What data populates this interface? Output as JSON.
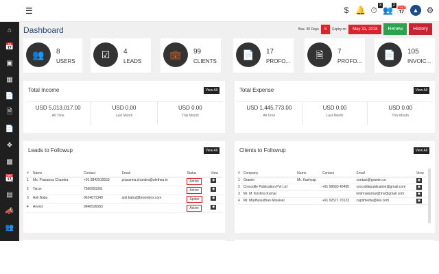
{
  "topbar": {
    "menu_icon": "hamburger-icon",
    "icons": [
      "dollar-icon",
      "bell-icon",
      "timer-icon",
      "users-icon",
      "calendar-icon",
      "settings-icon"
    ],
    "timer_badge": "3",
    "users_badge": "2"
  },
  "sidebar": {
    "items": [
      "home-icon",
      "calendar-icon",
      "id-card-icon",
      "address-card-icon",
      "file-icon",
      "file-text-icon",
      "file-icon",
      "cubes-icon",
      "money-icon",
      "calendar-check-icon",
      "list-icon",
      "bullhorn-icon",
      "users-icon"
    ]
  },
  "header": {
    "title": "Dashboard",
    "sub_label": "Bus. 30 Days",
    "days": "8",
    "expire_label": "Expiry on",
    "expire_date": "May 31, 2018",
    "renew": "Renew",
    "history": "History"
  },
  "stats": [
    {
      "value": "8",
      "label": "USERS",
      "icon": "users-icon"
    },
    {
      "value": "4",
      "label": "LEADS",
      "icon": "check-square-icon"
    },
    {
      "value": "99",
      "label": "CLIENTS",
      "icon": "briefcase-icon"
    },
    {
      "value": "17",
      "label": "PROFO...",
      "icon": "file-icon"
    },
    {
      "value": "7",
      "label": "PROFO...",
      "icon": "file-text-icon"
    },
    {
      "value": "105",
      "label": "INVOIC...",
      "icon": "file-icon"
    }
  ],
  "income": {
    "title": "Total Income",
    "view_all": "View All",
    "cols": [
      {
        "value": "USD 5,013,017.00",
        "label": "All Time"
      },
      {
        "value": "USD 0.00",
        "label": "Last Month"
      },
      {
        "value": "USD 0.00",
        "label": "This Month"
      }
    ]
  },
  "expense": {
    "title": "Total Expense",
    "view_all": "View All",
    "cols": [
      {
        "value": "USD 1,445,773.00",
        "label": "All Time"
      },
      {
        "value": "USD 0.00",
        "label": "Last Month"
      },
      {
        "value": "USD 0.00",
        "label": "This Month"
      }
    ]
  },
  "leads": {
    "title": "Leads to Followup",
    "view_all": "View All",
    "headers": [
      "#",
      "Name",
      "Contact",
      "Email",
      "Status",
      "View"
    ],
    "rows": [
      {
        "n": "1",
        "name": "Ms. Prasanna Chandra",
        "contact": "+91 8842910553",
        "email": "prasanna.chandra@alethea.in",
        "status": "Active"
      },
      {
        "n": "2",
        "name": "Tarun",
        "contact": "7566991061",
        "email": "",
        "status": "Active"
      },
      {
        "n": "3",
        "name": "Anil Babu",
        "contact": "9624671340",
        "email": "anil.babu@brownbox.com",
        "status": "Spoke"
      },
      {
        "n": "4",
        "name": "Arvind",
        "contact": "9848526583",
        "email": "",
        "status": "Active"
      }
    ]
  },
  "clients": {
    "title": "Clients to Followup",
    "view_all": "View All",
    "headers": [
      "#",
      "Company",
      "Name",
      "Contact",
      "Email",
      "View"
    ],
    "rows": [
      {
        "n": "1",
        "company": "Gramin",
        "name": "Mr. Kashyap",
        "contact": "",
        "email": "contact@gramin.co"
      },
      {
        "n": "2",
        "company": "Crocodile Publication Pvt Ltd",
        "name": "",
        "contact": "+91 99583 40495",
        "email": "crocodilepublication@gmail.com"
      },
      {
        "n": "3",
        "company": "Mr. M. Krishna Kumar",
        "name": "",
        "contact": "",
        "email": "krishnakumar@tnv@gmail.com"
      },
      {
        "n": "4",
        "company": "Mr. Madhusudhan Minaisel",
        "name": "",
        "contact": "+91 92571 70123",
        "email": "capitmedia@live.com"
      }
    ]
  }
}
